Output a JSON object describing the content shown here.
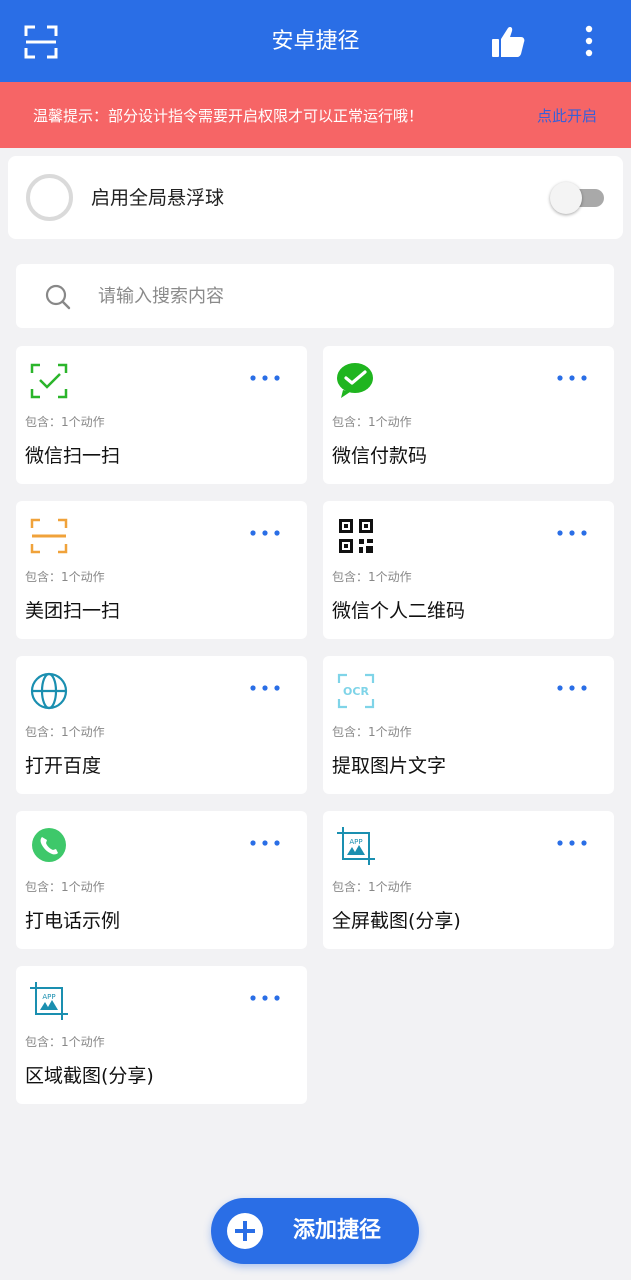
{
  "appbar": {
    "title": "安卓捷径"
  },
  "notice": {
    "text": "温馨提示：部分设计指令需要开启权限才可以正常运行哦！",
    "link": "点此开启"
  },
  "float_ball": {
    "label": "启用全局悬浮球",
    "enabled": false
  },
  "search": {
    "placeholder": "请输入搜索内容"
  },
  "shortcuts": [
    {
      "name": "微信扫一扫",
      "sub": "包含：1个动作",
      "icon": "wechat-scan-icon"
    },
    {
      "name": "微信付款码",
      "sub": "包含：1个动作",
      "icon": "wechat-logo-icon"
    },
    {
      "name": "美团扫一扫",
      "sub": "包含：1个动作",
      "icon": "meituan-scan-icon"
    },
    {
      "name": "微信个人二维码",
      "sub": "包含：1个动作",
      "icon": "qr-code-icon"
    },
    {
      "name": "打开百度",
      "sub": "包含：1个动作",
      "icon": "globe-icon"
    },
    {
      "name": "提取图片文字",
      "sub": "包含：1个动作",
      "icon": "ocr-icon"
    },
    {
      "name": "打电话示例",
      "sub": "包含：1个动作",
      "icon": "phone-icon"
    },
    {
      "name": "全屏截图(分享)",
      "sub": "包含：1个动作",
      "icon": "app-screenshot-icon"
    },
    {
      "name": "区域截图(分享)",
      "sub": "包含：1个动作",
      "icon": "app-screenshot-icon"
    }
  ],
  "fab": {
    "label": "添加捷径"
  },
  "colors": {
    "primary": "#2a6ee6",
    "notice": "#f66566",
    "link": "#3860d8"
  }
}
